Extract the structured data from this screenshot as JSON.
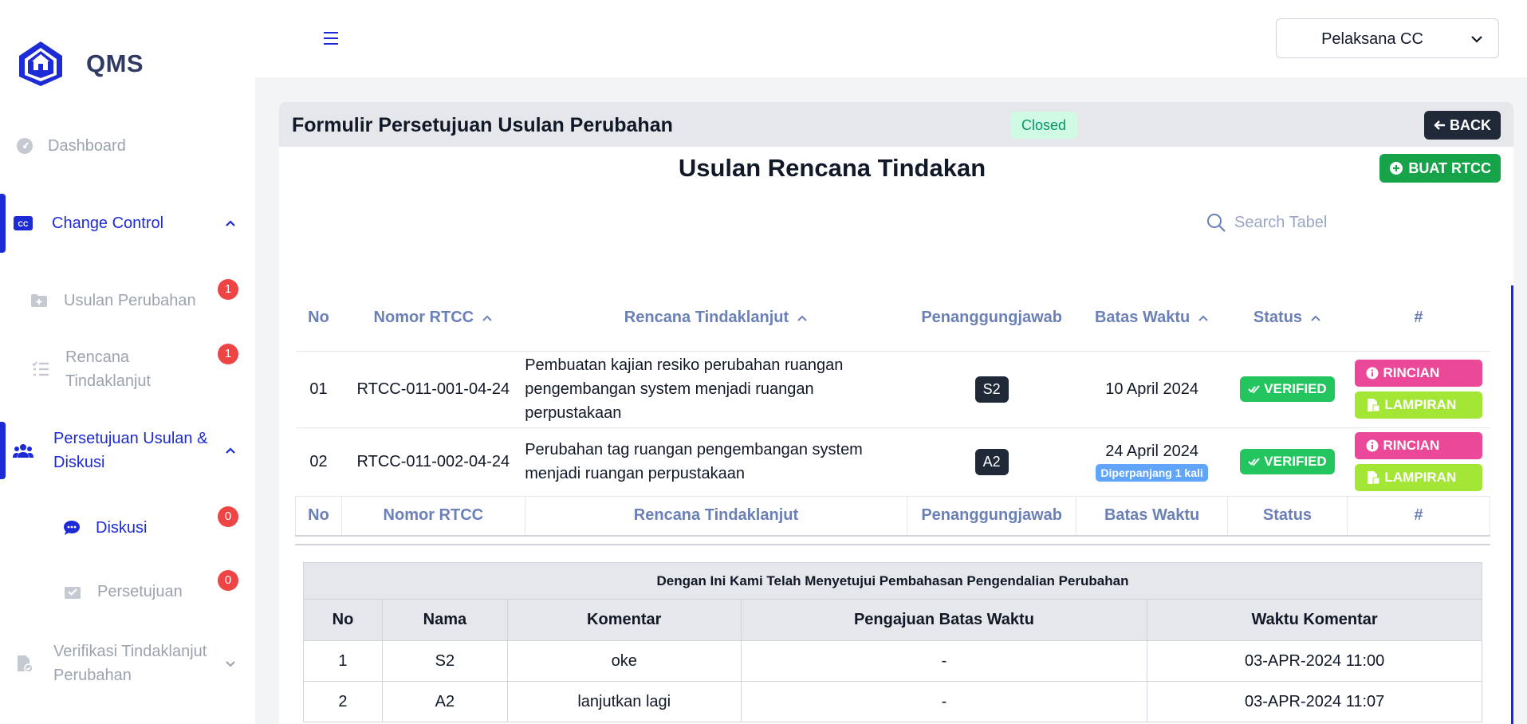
{
  "app": {
    "name": "QMS"
  },
  "header": {
    "role": "Pelaksana CC"
  },
  "sidebar": {
    "dashboard": "Dashboard",
    "change_control": "Change Control",
    "usulan_perubahan": {
      "label": "Usulan Perubahan",
      "count": "1"
    },
    "rencana_tindaklanjut": {
      "line1": "Rencana",
      "line2": "Tindaklanjut",
      "count": "1"
    },
    "persetujuan_usulan": {
      "line1": "Persetujuan Usulan &",
      "line2": "Diskusi"
    },
    "diskusi": {
      "label": "Diskusi",
      "count": "0"
    },
    "persetujuan": {
      "label": "Persetujuan",
      "count": "0"
    },
    "verifikasi": {
      "line1": "Verifikasi Tindaklanjut",
      "line2": "Perubahan"
    }
  },
  "card": {
    "title": "Formulir Persetujuan Usulan Perubahan",
    "status": "Closed",
    "back_label": "BACK",
    "section_title": "Usulan Rencana Tindakan",
    "create_label": "BUAT RTCC",
    "search_placeholder": "Search Tabel"
  },
  "rtcc_table": {
    "headers": [
      "No",
      "Nomor RTCC",
      "Rencana Tindaklanjut",
      "Penanggungjawab",
      "Batas Waktu",
      "Status",
      "#"
    ],
    "rows": [
      {
        "no": "01",
        "nomor": "RTCC-011-001-04-24",
        "rencana": "Pembuatan kajian resiko perubahan ruangan pengembangan system menjadi ruangan perpustakaan",
        "pj": "S2",
        "batas": "10 April 2024",
        "ext": "",
        "status": "VERIFIED"
      },
      {
        "no": "02",
        "nomor": "RTCC-011-002-04-24",
        "rencana": "Perubahan tag ruangan pengembangan system menjadi ruangan perpustakaan",
        "pj": "A2",
        "batas": "24 April 2024",
        "ext": "Diperpanjang 1 kali",
        "status": "VERIFIED"
      }
    ],
    "rincian_label": "RINCIAN",
    "lampiran_label": "LAMPIRAN"
  },
  "approval_table": {
    "caption": "Dengan Ini Kami Telah Menyetujui Pembahasan Pengendalian Perubahan",
    "headers": [
      "No",
      "Nama",
      "Komentar",
      "Pengajuan Batas Waktu",
      "Waktu Komentar"
    ],
    "rows": [
      {
        "no": "1",
        "nama": "S2",
        "komentar": "oke",
        "pengajuan": "-",
        "waktu": "03-APR-2024 11:00"
      },
      {
        "no": "2",
        "nama": "A2",
        "komentar": "lanjutkan lagi",
        "pengajuan": "-",
        "waktu": "03-APR-2024 11:07"
      }
    ]
  },
  "colors": {
    "primary": "#1d2bd6",
    "verified": "#22c55e",
    "rincian": "#ec4899",
    "lampiran": "#a3e635",
    "buat": "#16a34a",
    "badge": "#ef4444"
  },
  "icons": [
    "qms-logo-icon",
    "dashboard-icon",
    "cc-icon",
    "chevron-up-icon",
    "folder-plus-icon",
    "list-check-icon",
    "users-icon",
    "chat-icon",
    "inbox-check-icon",
    "file-check-icon",
    "chevron-down-icon",
    "hamburger-icon",
    "arrow-left-icon",
    "plus-circle-icon",
    "search-icon",
    "check-double-icon",
    "info-circle-icon",
    "file-icon",
    "sort-icon"
  ]
}
